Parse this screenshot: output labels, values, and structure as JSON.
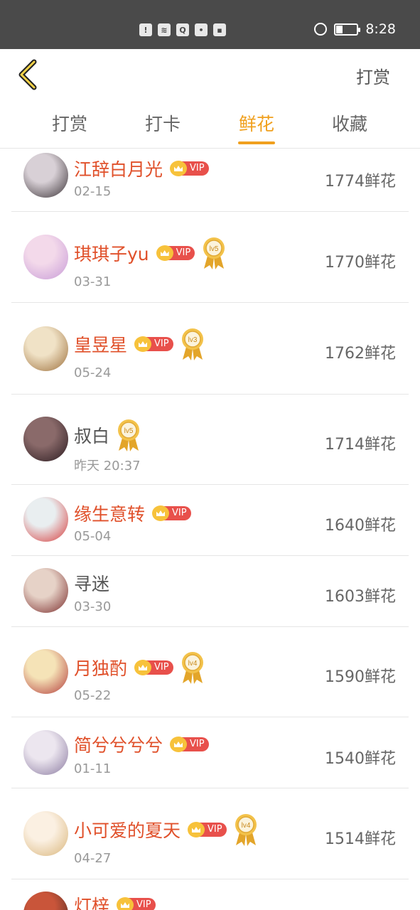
{
  "status_bar": {
    "time": "8:28",
    "left_icons": [
      "sim-alert-icon",
      "wifi-icon",
      "qq-icon",
      "bulb-icon",
      "app-icon"
    ],
    "battery_level": 0.3
  },
  "nav": {
    "action_label": "打赏"
  },
  "tabs": [
    {
      "label": "打赏",
      "active": false
    },
    {
      "label": "打卡",
      "active": false
    },
    {
      "label": "鲜花",
      "active": true
    },
    {
      "label": "收藏",
      "active": false
    }
  ],
  "vip_label": "VIP",
  "colors": {
    "accent": "#f0a01e",
    "vip_name": "#e0502a",
    "vip_badge": "#e8504b",
    "crown": "#f7c23b",
    "status_bar": "#4a4a4a"
  },
  "rows": [
    {
      "name": "江辞白月光",
      "vip": true,
      "level": "",
      "date": "02-15",
      "count": "1774鲜花",
      "avatar_colors": [
        "#d8d0d6",
        "#3a3236"
      ]
    },
    {
      "name": "琪琪子yu",
      "vip": true,
      "level": "lv5",
      "date": "03-31",
      "count": "1770鲜花",
      "avatar_colors": [
        "#f3d9ea",
        "#c79ad7"
      ]
    },
    {
      "name": "皇昱星",
      "vip": true,
      "level": "lv3",
      "date": "05-24",
      "count": "1762鲜花",
      "avatar_colors": [
        "#f0e2c6",
        "#9c6e3a"
      ]
    },
    {
      "name": "叔白",
      "vip": false,
      "level": "lv5",
      "date": "昨天 20:37",
      "count": "1714鲜花",
      "avatar_colors": [
        "#8a6a6a",
        "#2a1a1f"
      ]
    },
    {
      "name": "缘生意转",
      "vip": true,
      "level": "",
      "date": "05-04",
      "count": "1640鲜花",
      "avatar_colors": [
        "#e9eef0",
        "#d63a3a"
      ]
    },
    {
      "name": "寻迷",
      "vip": false,
      "level": "",
      "date": "03-30",
      "count": "1603鲜花",
      "avatar_colors": [
        "#e6d2c7",
        "#7a2a2a"
      ]
    },
    {
      "name": "月独酌",
      "vip": true,
      "level": "lv4",
      "date": "05-22",
      "count": "1590鲜花",
      "avatar_colors": [
        "#f5e3b7",
        "#b23a3a"
      ]
    },
    {
      "name": "简兮兮兮兮",
      "vip": true,
      "level": "",
      "date": "01-11",
      "count": "1540鲜花",
      "avatar_colors": [
        "#ece6ef",
        "#8a7aa0"
      ]
    },
    {
      "name": "小可爱的夏天",
      "vip": true,
      "level": "lv4",
      "date": "04-27",
      "count": "1514鲜花",
      "avatar_colors": [
        "#fbf0e2",
        "#d9b57a"
      ]
    },
    {
      "name": "灯梓",
      "vip": true,
      "level": "",
      "date": "",
      "count": "",
      "avatar_colors": [
        "#c9553a",
        "#4a2a22"
      ]
    }
  ]
}
